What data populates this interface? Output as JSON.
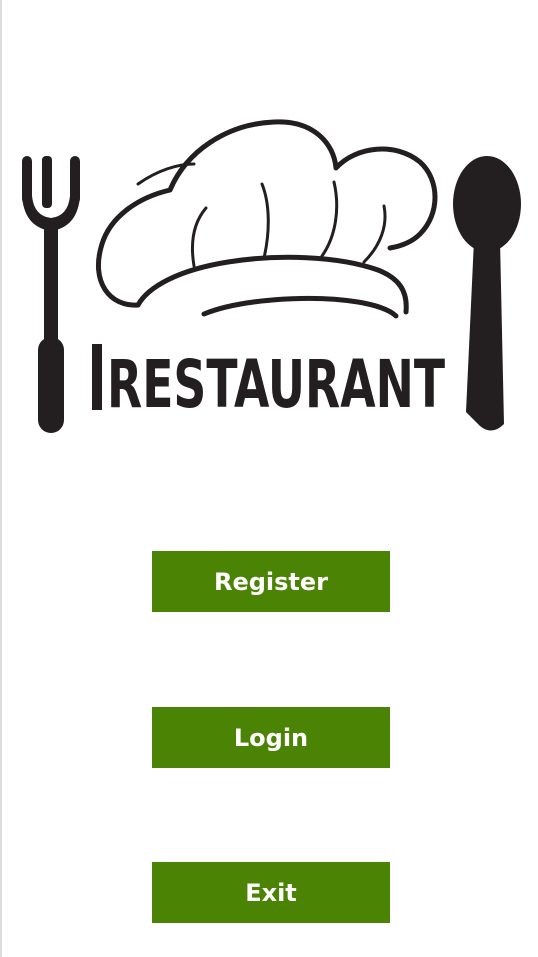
{
  "logo": {
    "text": "RESTAURANT",
    "color": "#231f20",
    "icons": [
      "fork-icon",
      "chef-hat-icon",
      "spoon-icon"
    ]
  },
  "buttons": {
    "register": "Register",
    "login": "Login",
    "exit": "Exit"
  },
  "colors": {
    "button_bg": "#4b8304",
    "button_text": "#ffffff",
    "background": "#ffffff"
  }
}
